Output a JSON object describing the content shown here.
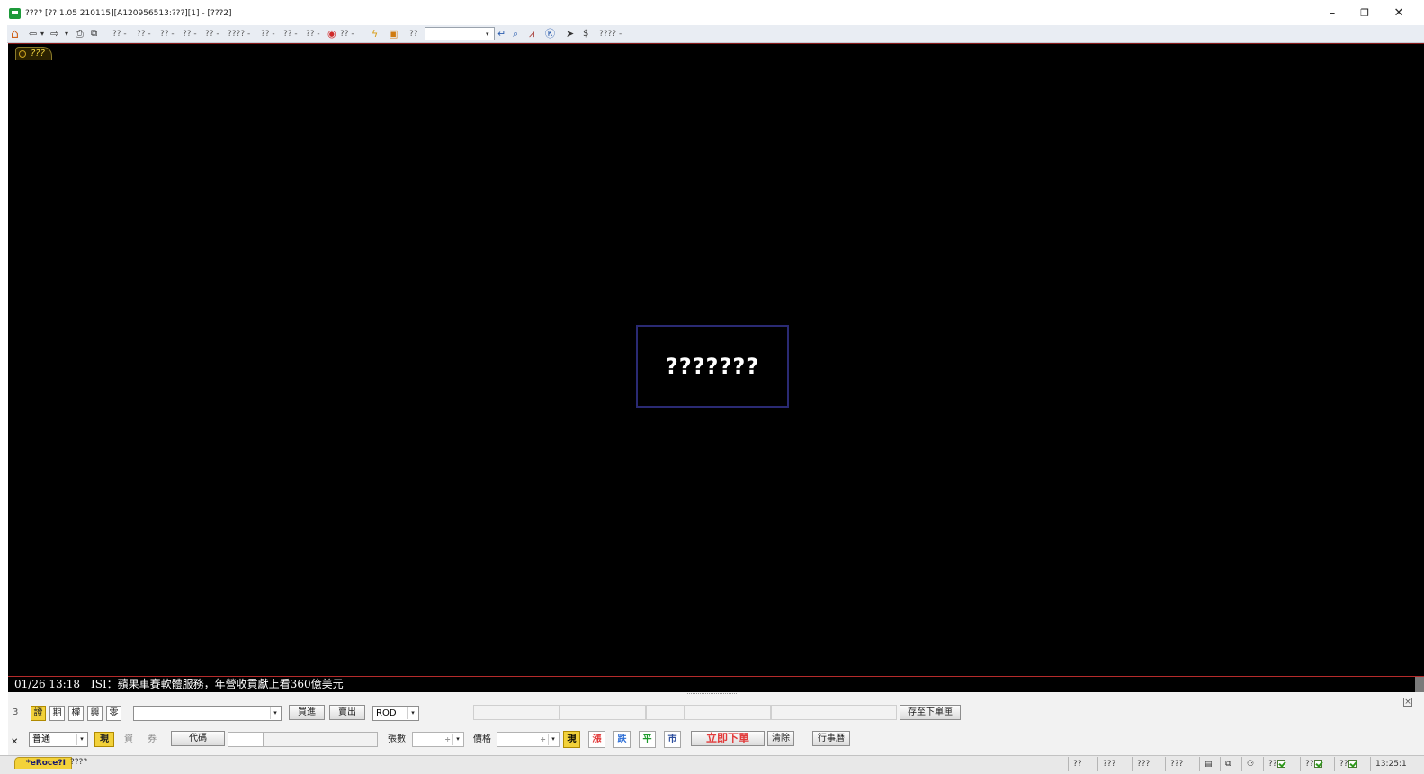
{
  "window": {
    "title": "???? [?? 1.05 210115][A120956513:???][1] - [???2]",
    "minimize": "–",
    "restore": "❐",
    "close": "✕"
  },
  "toolbar": {
    "icons": [
      "home-icon",
      "back-icon",
      "forward-icon",
      "print-icon",
      "export-icon",
      "dropdown-marker-icon",
      "alert-icon",
      "lightning-icon",
      "window-icon",
      "enter-icon",
      "search-icon",
      "chart-icon",
      "k-line-icon",
      "cursor-icon",
      "dollar-icon"
    ],
    "menus": [
      "?? -",
      "?? -",
      "?? -",
      "?? -",
      "?? -",
      "???? -",
      "?? -",
      "?? -",
      "?? -"
    ],
    "menu_after_alert": "?? -",
    "label_after_icons": "??",
    "combo_value": "",
    "last_menu": "???? -"
  },
  "main": {
    "tab_label": "???",
    "loading_text": "???????",
    "background": "#000000",
    "tab_color": "#f2d640"
  },
  "ticker": {
    "text": "01/26 13:18　ISI：蘋果車賽軟體服務，年營收貢獻上看360億美元"
  },
  "order": {
    "row1": {
      "prefix": "3",
      "type_chips": [
        {
          "label": "證",
          "active": true
        },
        {
          "label": "期",
          "active": false
        },
        {
          "label": "權",
          "active": false
        },
        {
          "label": "興",
          "active": false
        },
        {
          "label": "零",
          "active": false
        }
      ],
      "account_value": "",
      "buy_label": "買進",
      "sell_label": "賣出",
      "tif_value": "ROD",
      "save_label": "存至下單匣"
    },
    "row2": {
      "close_marker": "✕",
      "mode_value": "普通",
      "cash_chip": "現",
      "margin_chip": "資",
      "short_chip": "券",
      "code_button": "代碼",
      "code_value": "",
      "name_value": "",
      "qty_label": "張數",
      "qty_value": "",
      "price_label": "價格",
      "price_value": "",
      "price_chips": [
        {
          "label": "現",
          "color": "#000000",
          "active": true
        },
        {
          "label": "漲",
          "color": "#e23b3b",
          "active": false
        },
        {
          "label": "跌",
          "color": "#2e6fd6",
          "active": false
        },
        {
          "label": "平",
          "color": "#1c9a2a",
          "active": false
        },
        {
          "label": "市",
          "color": "#2e4f9e",
          "active": false
        }
      ],
      "submit_label": "立即下單",
      "clear_label": "清除",
      "calendar_label": "行事曆"
    }
  },
  "statusbar": {
    "active_tab": "*eRoce?I",
    "second_tab": "????",
    "cells": [
      "??",
      "???",
      "???",
      "???"
    ],
    "check_labels": [
      "??",
      "??",
      "??"
    ],
    "clock": "13:25:1"
  },
  "colors": {
    "accent_yellow": "#f2d13a",
    "up_red": "#e23b3b",
    "down_green": "#1c9a2a"
  }
}
